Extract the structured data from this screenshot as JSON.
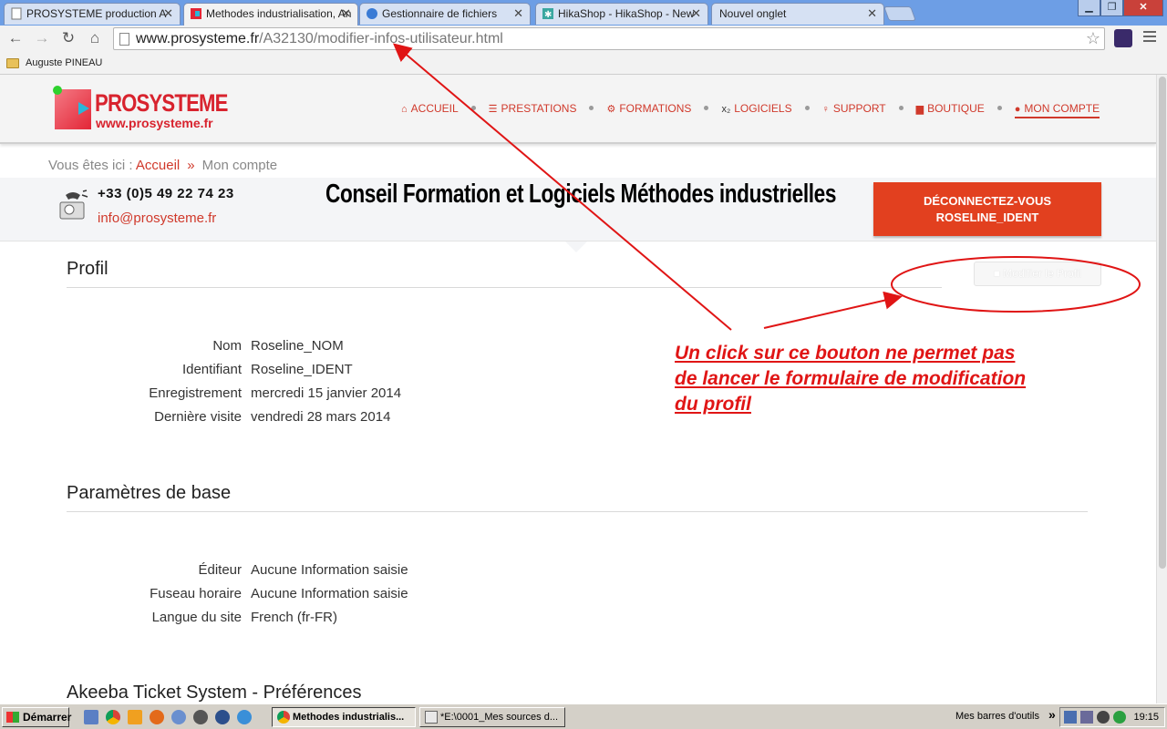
{
  "browser": {
    "tabs": [
      {
        "title": "PROSYSTEME production A",
        "active": false
      },
      {
        "title": "Methodes industrialisation, An",
        "active": true
      },
      {
        "title": "Gestionnaire de fichiers",
        "active": false
      },
      {
        "title": "HikaShop - HikaShop - New",
        "active": false
      },
      {
        "title": "Nouvel onglet",
        "active": false
      }
    ],
    "url_host": "www.prosysteme.fr",
    "url_path": "/A32130/modifier-infos-utilisateur.html",
    "bookmark_folder": "Auguste PINEAU"
  },
  "site": {
    "logo_title": "PROSYSTEME",
    "logo_url": "www.prosysteme.fr",
    "nav": [
      {
        "label": "ACCUEIL",
        "icon": "home-icon",
        "glyph": "⌂"
      },
      {
        "label": "PRESTATIONS",
        "icon": "list-icon",
        "glyph": "☰"
      },
      {
        "label": "FORMATIONS",
        "icon": "gears-icon",
        "glyph": "⚙"
      },
      {
        "label": "LOGICIELS",
        "icon": "subscript-icon",
        "glyph": "x₂"
      },
      {
        "label": "SUPPORT",
        "icon": "lightbulb-icon",
        "glyph": "♀"
      },
      {
        "label": "BOUTIQUE",
        "icon": "cart-icon",
        "glyph": "▆"
      },
      {
        "label": "MON COMPTE",
        "icon": "user-icon",
        "glyph": "●",
        "current": true
      }
    ],
    "breadcrumb": {
      "prefix": "Vous êtes ici :",
      "home": "Accueil",
      "separator": "»",
      "current": "Mon compte"
    },
    "phone": "+33 (0)5 49 22 74 23",
    "email": "info@prosysteme.fr",
    "slogan": "Conseil Formation et Logiciels Méthodes industrielles",
    "logout_line1": "DÉCONNECTEZ-VOUS",
    "logout_line2": "ROSELINE_IDENT",
    "accent_color": "#d0392b",
    "button_color": "#e2401f"
  },
  "profile": {
    "title": "Profil",
    "edit_button": "Modifier le Profil",
    "fields": [
      {
        "label": "Nom",
        "value": "Roseline_NOM"
      },
      {
        "label": "Identifiant",
        "value": "Roseline_IDENT"
      },
      {
        "label": "Enregistrement",
        "value": "mercredi 15 janvier 2014"
      },
      {
        "label": "Dernière visite",
        "value": "vendredi 28 mars 2014"
      }
    ]
  },
  "basic_params": {
    "title": "Paramètres de base",
    "fields": [
      {
        "label": "Éditeur",
        "value": "Aucune Information saisie"
      },
      {
        "label": "Fuseau horaire",
        "value": "Aucune Information saisie"
      },
      {
        "label": "Langue du site",
        "value": "French (fr-FR)"
      }
    ]
  },
  "ticket_prefs": {
    "title": "Akeeba Ticket System - Préférences"
  },
  "annotation": {
    "lines": [
      "Un click sur ce bouton ne permet pas",
      "de lancer le formulaire de modification",
      "du profil"
    ],
    "color": "#e01515"
  },
  "taskbar": {
    "start": "Démarrer",
    "tasks": [
      {
        "label": "Methodes industrialis...",
        "active": true
      },
      {
        "label": "*E:\\0001_Mes sources d...",
        "active": false
      }
    ],
    "toolbars_label": "Mes barres d'outils",
    "chevron": "»",
    "clock": "19:15"
  }
}
